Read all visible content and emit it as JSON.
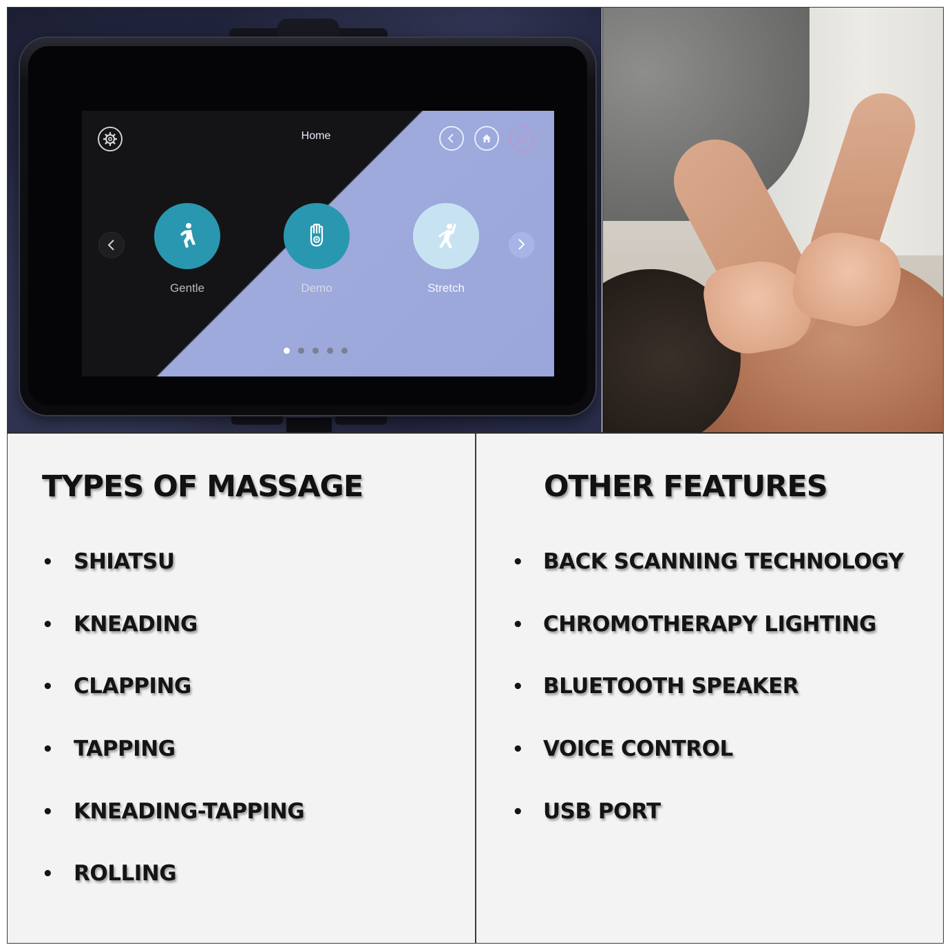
{
  "tablet_screen": {
    "title": "Home",
    "modes": [
      {
        "label": "Gentle",
        "icon": "gentle-person-icon"
      },
      {
        "label": "Demo",
        "icon": "hand-icon"
      },
      {
        "label": "Stretch",
        "icon": "stretch-person-icon"
      }
    ],
    "page_count": 5,
    "active_page": 1,
    "accent_color": "#2a97b0"
  },
  "massage_types": {
    "heading": "TYPES OF MASSAGE",
    "items": [
      "SHIATSU",
      "KNEADING",
      "CLAPPING",
      "TAPPING",
      "KNEADING-TAPPING",
      "ROLLING"
    ]
  },
  "other_features": {
    "heading": "OTHER FEATURES",
    "items": [
      "BACK SCANNING TECHNOLOGY",
      "CHROMOTHERAPY LIGHTING",
      "BLUETOOTH SPEAKER",
      "VOICE CONTROL",
      "USB PORT"
    ]
  }
}
